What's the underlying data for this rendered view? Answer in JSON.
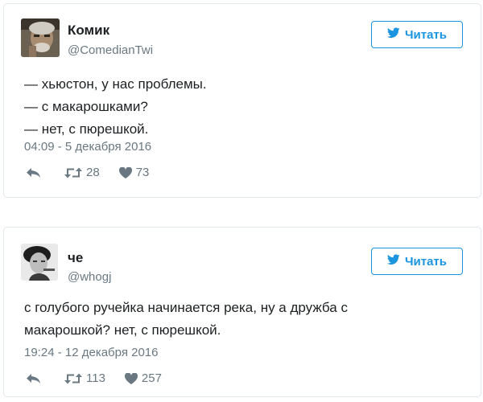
{
  "tweets": [
    {
      "name": "Комик",
      "handle": "@ComedianTwi",
      "follow_label": "Читать",
      "lines": [
        "— хьюстон, у нас проблемы.",
        "— с макарошками?",
        "— нет, с пюрешкой."
      ],
      "timestamp": "04:09 - 5 декабря 2016",
      "retweets": "28",
      "likes": "73"
    },
    {
      "name": "че",
      "handle": "@whogj",
      "follow_label": "Читать",
      "lines": [
        "с голубого ручейка начинается река, ну а дружба с",
        "макарошкой? нет, с пюрешкой."
      ],
      "timestamp": "19:24 - 12 декабря 2016",
      "retweets": "113",
      "likes": "257"
    }
  ],
  "icons": {
    "follow": "twitter-bird-icon",
    "reply": "reply-arrow-icon",
    "retweet": "retweet-icon",
    "like": "heart-icon"
  },
  "colors": {
    "accent": "#1b95e0",
    "text": "#1c2022",
    "muted": "#697882",
    "border": "#e1e8ed"
  }
}
